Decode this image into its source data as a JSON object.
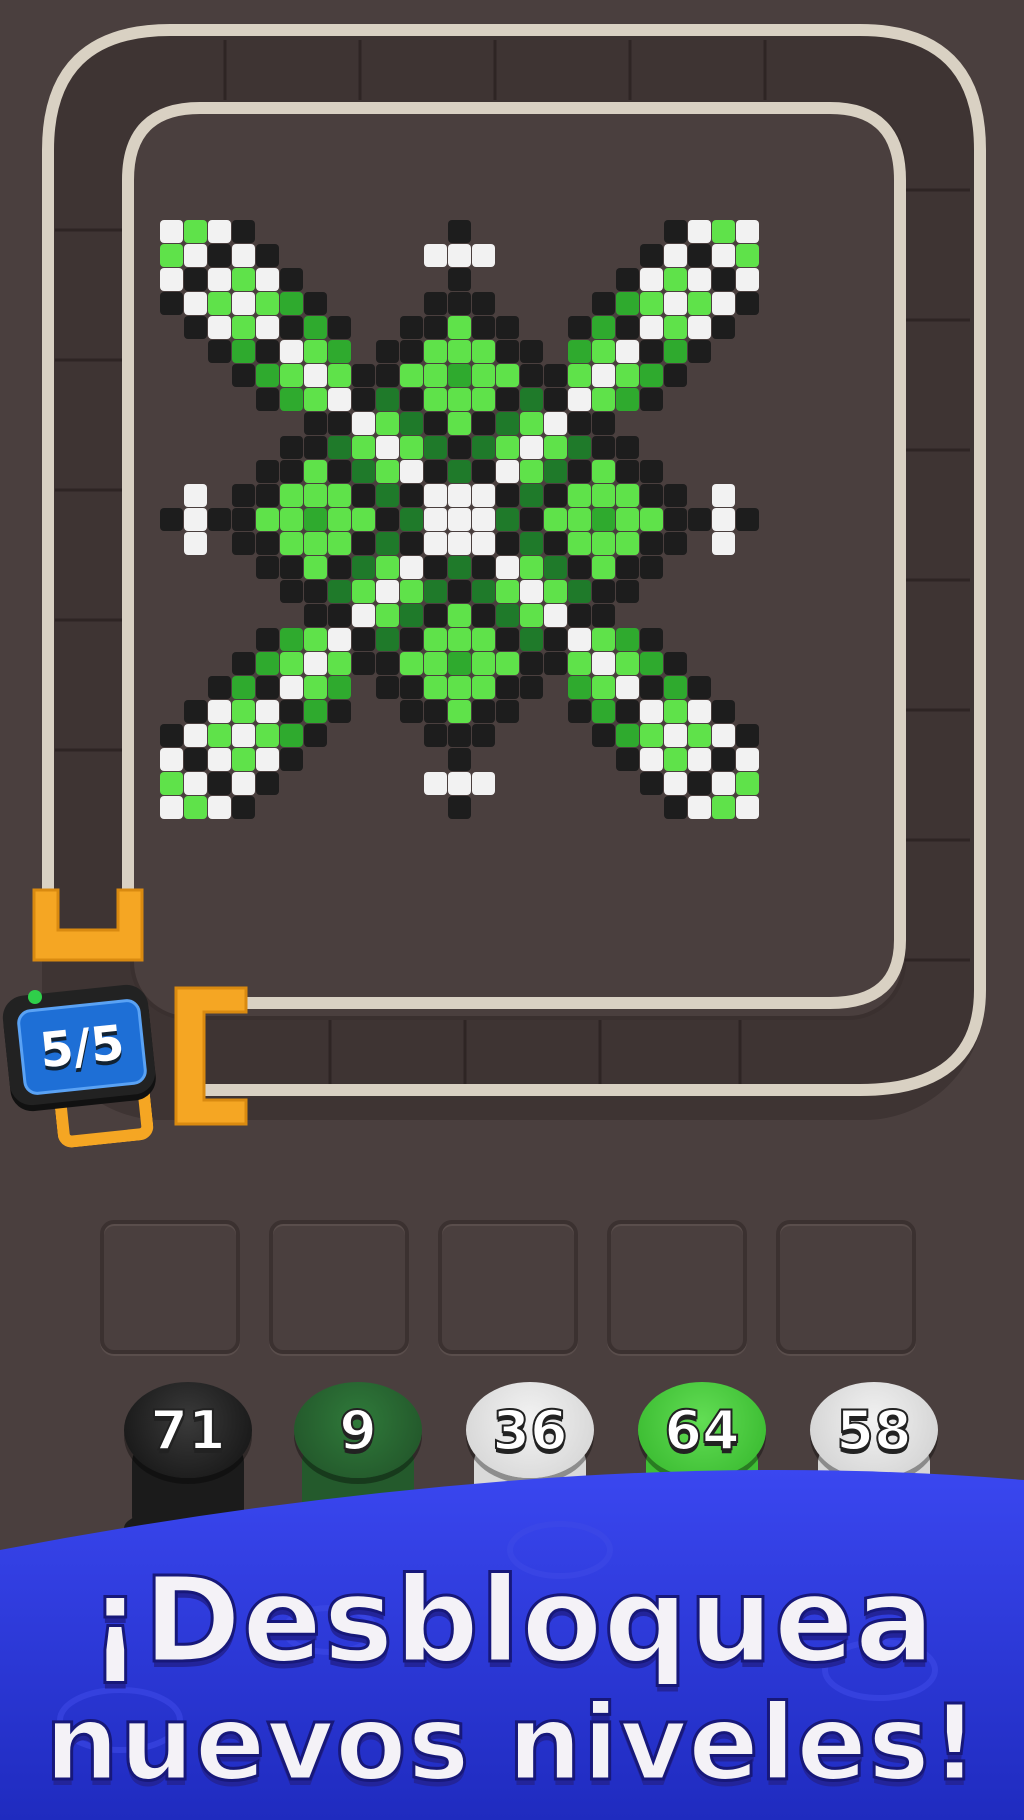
{
  "game": {
    "counter": {
      "text": "5/5"
    },
    "slots": [
      {
        "state": "empty"
      },
      {
        "state": "empty"
      },
      {
        "state": "empty"
      },
      {
        "state": "empty"
      },
      {
        "state": "empty"
      }
    ],
    "spools": [
      {
        "count": "71",
        "color": "#1b1b1b",
        "light": "#3a3a3a"
      },
      {
        "count": "9",
        "color": "#245a2c",
        "light": "#2f7a3a"
      },
      {
        "count": "36",
        "color": "#d9d9d9",
        "light": "#f3f3f3"
      },
      {
        "count": "64",
        "color": "#3fbf35",
        "light": "#62dd54"
      },
      {
        "count": "58",
        "color": "#d6d6d6",
        "light": "#f2f2f2"
      }
    ]
  },
  "banner": {
    "line1": "¡Desbloquea",
    "line2": "nuevos niveles!",
    "color": "#2a36d8"
  },
  "colors": {
    "background": "#4a3f3e",
    "track": "#d9d1c3",
    "clip": "#f5a623",
    "dark_green": "#1f7a2a",
    "mid_green": "#2faa2e",
    "light_green": "#5fe24a",
    "white": "#f2f2f2",
    "black": "#1d1d1d"
  }
}
